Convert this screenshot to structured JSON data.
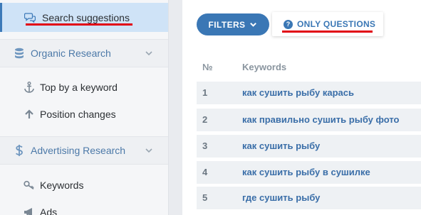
{
  "sidebar": {
    "active_item": {
      "label": "Search suggestions",
      "icon": "speech-bubbles-icon"
    },
    "sections": [
      {
        "label": "Organic Research",
        "icon": "database-icon",
        "items": [
          {
            "label": "Top by a keyword",
            "icon": "anchor-icon"
          },
          {
            "label": "Position changes",
            "icon": "arrow-up-icon"
          }
        ]
      },
      {
        "label": "Advertising Research",
        "icon": "dollar-icon",
        "items": [
          {
            "label": "Keywords",
            "icon": "key-icon"
          },
          {
            "label": "Ads",
            "icon": "megaphone-icon"
          }
        ]
      }
    ]
  },
  "toolbar": {
    "filters_label": "FILTERS",
    "only_questions_label": "ONLY QUESTIONS"
  },
  "table": {
    "headers": {
      "num": "№",
      "keywords": "Keywords"
    },
    "rows": [
      {
        "num": "1",
        "keyword": "как сушить рыбу карась"
      },
      {
        "num": "2",
        "keyword": "как правильно сушить рыбу фото"
      },
      {
        "num": "3",
        "keyword": "как сушить рыбу"
      },
      {
        "num": "4",
        "keyword": "как сушить рыбу в сушилке"
      },
      {
        "num": "5",
        "keyword": "где сушить рыбу"
      }
    ]
  },
  "colors": {
    "accent": "#3a77b5",
    "active_bg": "#cfe3f7",
    "highlight_underline": "#e10012"
  }
}
